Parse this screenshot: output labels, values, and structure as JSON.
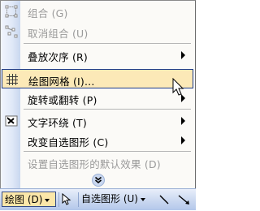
{
  "menu": {
    "items": [
      {
        "label": "组合 (G)",
        "disabled": true,
        "icon": "group-icon"
      },
      {
        "label": "取消组合 (U)",
        "disabled": true,
        "icon": "ungroup-icon"
      },
      {
        "label": "叠放次序 (R)",
        "submenu": true
      },
      {
        "label": "绘图网格 (I)...",
        "highlighted": true,
        "icon": "grid-icon"
      },
      {
        "label": "旋转或翻转 (P)",
        "submenu": true
      },
      {
        "label": "文字环绕 (T)",
        "submenu": true,
        "icon": "text-wrap-icon"
      },
      {
        "label": "改变自选图形 (C)",
        "submenu": true
      },
      {
        "label": "设置自选图形的默认效果 (D)",
        "disabled": true
      }
    ],
    "expand_icon": "chevron-double-down-icon"
  },
  "toolbar": {
    "draw_label": "绘图 (D)",
    "autoshapes_label": "自选图形 (U)",
    "icons": [
      "select-objects-icon",
      "line-icon",
      "arrow-icon"
    ]
  },
  "colors": {
    "highlight_fill": "#fce9b7",
    "highlight_border": "#1f3d8a",
    "gutter": "#dfe8f7",
    "disabled_text": "#9a9a9a",
    "toolbar": "#cad8f0"
  }
}
